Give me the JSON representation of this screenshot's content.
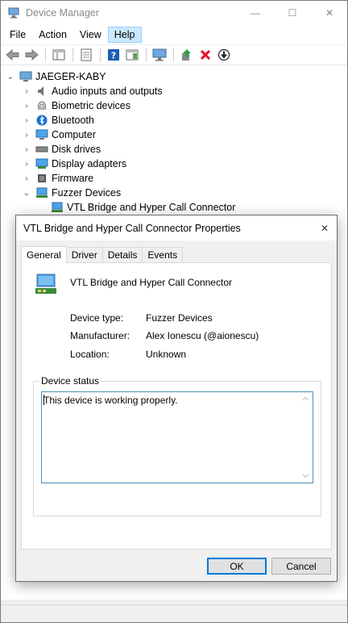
{
  "window": {
    "title": "Device Manager",
    "minimize_glyph": "—",
    "maximize_glyph": "☐",
    "close_glyph": "✕"
  },
  "menu": {
    "file": "File",
    "action": "Action",
    "view": "View",
    "help": "Help"
  },
  "toolbar": {
    "icons": [
      "back-arrow-icon",
      "forward-arrow-icon",
      "show-hide-console-tree-icon",
      "properties-icon",
      "help-icon",
      "show-hide-action-pane-icon",
      "scan-hardware-icon",
      "update-driver-icon",
      "uninstall-device-icon",
      "disable-device-icon"
    ]
  },
  "tree": {
    "root": "JAEGER-KABY",
    "items": [
      {
        "label": "Audio inputs and outputs",
        "icon": "speaker-icon",
        "expanded": false
      },
      {
        "label": "Biometric devices",
        "icon": "fingerprint-icon",
        "expanded": false
      },
      {
        "label": "Bluetooth",
        "icon": "bluetooth-icon",
        "expanded": false
      },
      {
        "label": "Computer",
        "icon": "monitor-icon",
        "expanded": false
      },
      {
        "label": "Disk drives",
        "icon": "disk-drive-icon",
        "expanded": false
      },
      {
        "label": "Display adapters",
        "icon": "display-adapter-icon",
        "expanded": false
      },
      {
        "label": "Firmware",
        "icon": "firmware-chip-icon",
        "expanded": false
      },
      {
        "label": "Fuzzer Devices",
        "icon": "network-device-icon",
        "expanded": true
      }
    ],
    "child": "VTL Bridge and Hyper Call Connector",
    "expand_glyph": "›",
    "collapse_glyph": "⌄",
    "root_glyph": "⌄"
  },
  "dialog": {
    "title": "VTL Bridge and Hyper Call Connector Properties",
    "close_glyph": "✕",
    "tabs": [
      "General",
      "Driver",
      "Details",
      "Events"
    ],
    "selected_tab": "General",
    "device_name": "VTL Bridge and Hyper Call Connector",
    "properties": [
      {
        "label": "Device type:",
        "value": "Fuzzer Devices"
      },
      {
        "label": "Manufacturer:",
        "value": "Alex Ionescu (@aionescu)"
      },
      {
        "label": "Location:",
        "value": "Unknown"
      }
    ],
    "status_group_label": "Device status",
    "status_text": "This device is working properly.",
    "ok_label": "OK",
    "cancel_label": "Cancel"
  },
  "colors": {
    "accent": "#0078d7",
    "menu_highlight": "#cce8ff",
    "uninstall_red": "#e81123",
    "help_blue": "#1c5fb5"
  }
}
